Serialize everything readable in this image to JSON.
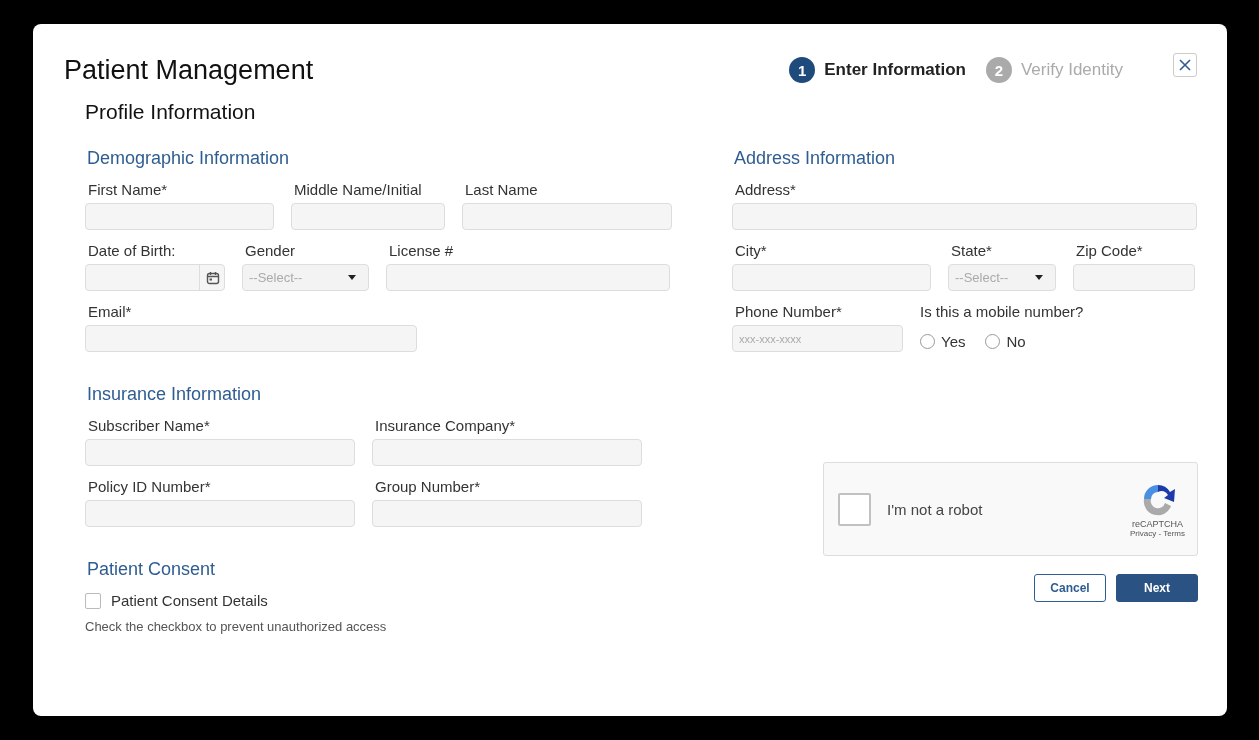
{
  "title": "Patient Management",
  "steps": [
    {
      "number": "1",
      "label": "Enter Information",
      "selected": true
    },
    {
      "number": "2",
      "label": "Verify Identity",
      "selected": false
    }
  ],
  "subtitle": "Profile Information",
  "left_sections": [
    {
      "heading": "Demographic Information",
      "rows": [
        [
          {
            "kind": "text",
            "label": "First Name*"
          },
          {
            "kind": "text",
            "label": "Middle Name/Initial"
          },
          {
            "kind": "text",
            "label": "Last Name"
          }
        ],
        [
          {
            "kind": "date",
            "label": "Date of Birth:"
          },
          {
            "kind": "select",
            "label": "Gender",
            "placeholder": "--Select--"
          },
          {
            "kind": "text",
            "label": "License #"
          }
        ],
        [
          {
            "kind": "text",
            "label": "Email*"
          }
        ]
      ]
    },
    {
      "heading": "Insurance Information",
      "rows": [
        [
          {
            "kind": "text",
            "label": "Subscriber Name*"
          },
          {
            "kind": "text",
            "label": "Insurance Company*"
          }
        ],
        [
          {
            "kind": "text",
            "label": "Policy ID Number*"
          },
          {
            "kind": "text",
            "label": "Group Number*"
          }
        ]
      ]
    }
  ],
  "right_sections": [
    {
      "heading": "Address Information",
      "rows": [
        [
          {
            "kind": "text",
            "label": "Address*"
          }
        ],
        [
          {
            "kind": "text",
            "label": "City*"
          },
          {
            "kind": "select",
            "label": "State*",
            "placeholder": "--Select--"
          },
          {
            "kind": "text",
            "label": "Zip Code*"
          }
        ],
        [
          {
            "kind": "text",
            "label": "Phone Number*",
            "placeholder": "xxx-xxx-xxxx"
          },
          {
            "kind": "radio",
            "label": "Is this a mobile number?",
            "options": [
              {
                "label": "Yes",
                "selected": false
              },
              {
                "label": "No",
                "selected": false
              }
            ]
          }
        ]
      ]
    }
  ],
  "consent": {
    "heading": "Patient Consent",
    "label": "Patient Consent Details",
    "checked": false,
    "hint": "Check the checkbox to prevent unauthorized access"
  },
  "captcha": {
    "label": "I'm not a robot",
    "checked": false,
    "brand": "reCAPTCHA",
    "links": "Privacy - Terms"
  },
  "buttons": [
    {
      "kind": "secondary",
      "label": "Cancel"
    },
    {
      "kind": "primary",
      "label": "Next"
    }
  ]
}
